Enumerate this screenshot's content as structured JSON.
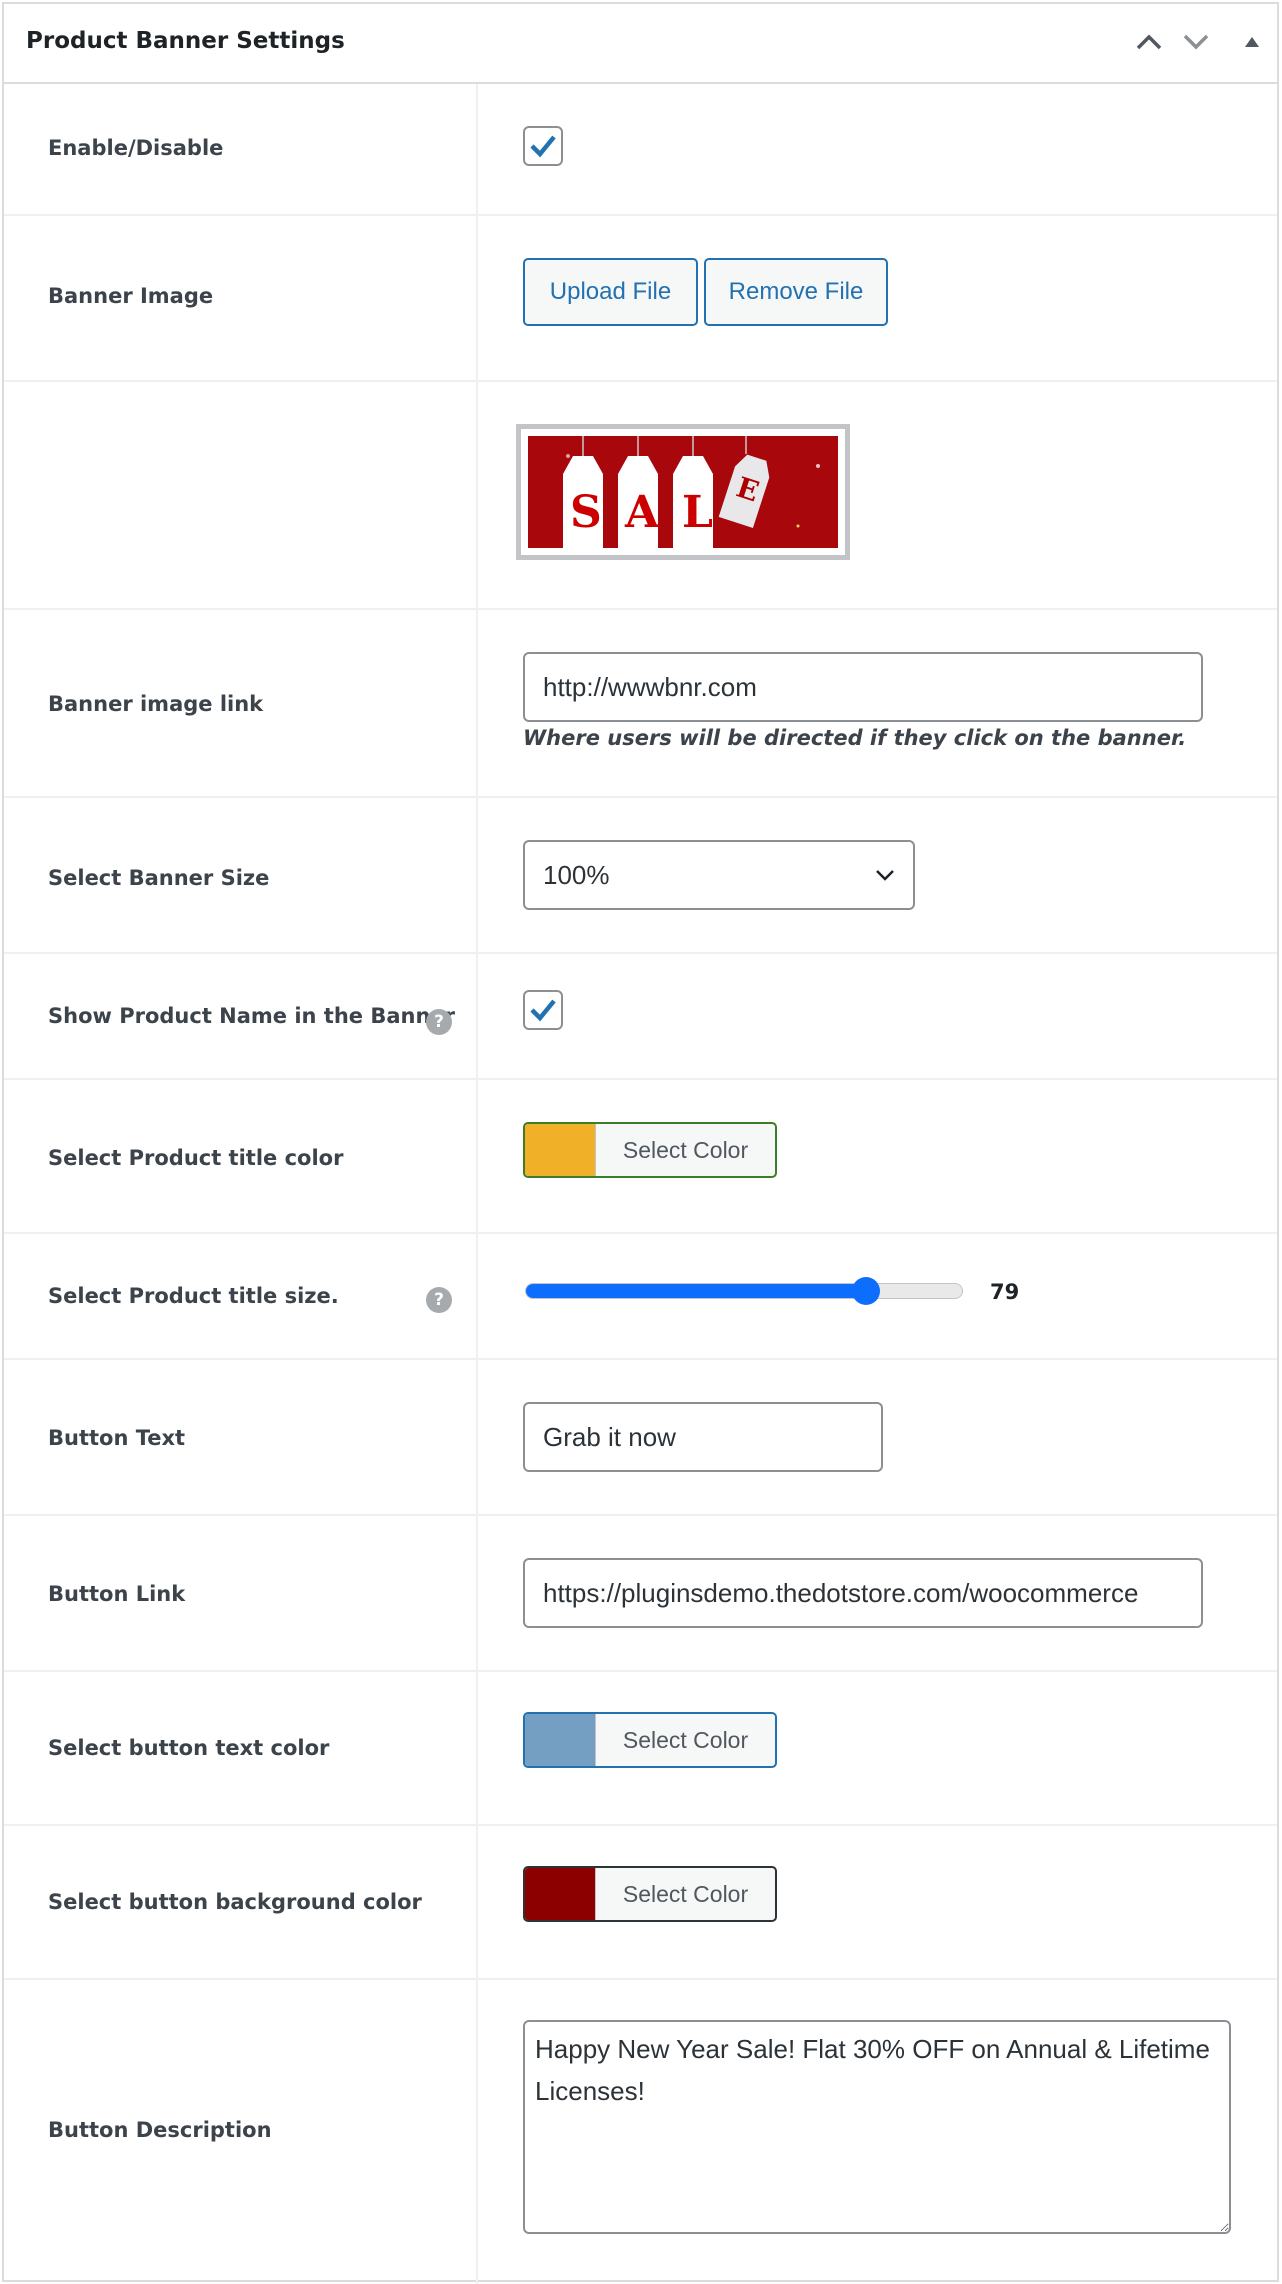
{
  "panel": {
    "title": "Product Banner Settings",
    "controls": [
      "chevron-up-icon",
      "chevron-down-icon",
      "triangle-up-icon"
    ]
  },
  "rows": {
    "enable": {
      "label": "Enable/Disable",
      "checked": true
    },
    "banner_image": {
      "label": "Banner Image",
      "upload_label": "Upload File",
      "remove_label": "Remove File"
    },
    "preview": {
      "letters": [
        "S",
        "A",
        "L",
        "E"
      ]
    },
    "banner_link": {
      "label": "Banner image link",
      "value": "http://wwwbnr.com",
      "description": "Where users will be directed if they click on the banner."
    },
    "banner_size": {
      "label": "Select Banner Size",
      "value": "100%"
    },
    "show_name": {
      "label": "Show Product Name in the Banner",
      "help": "?",
      "checked": true
    },
    "title_color": {
      "label": "Select Product title color",
      "button_label": "Select Color",
      "color": "#F0B027"
    },
    "title_size": {
      "label": "Select Product title size.",
      "help": "?",
      "value": "79",
      "slider_fraction": 0.78
    },
    "button_text": {
      "label": "Button Text",
      "value": "Grab it now"
    },
    "button_link": {
      "label": "Button Link",
      "value": "https://pluginsdemo.thedotstore.com/woocommerce"
    },
    "button_text_color": {
      "label": "Select button text color",
      "button_label": "Select Color",
      "color": "#749FC3"
    },
    "button_bg_color": {
      "label": "Select button background color",
      "button_label": "Select Color",
      "color": "#8C0000"
    },
    "button_description": {
      "label": "Button Description",
      "value": "Happy New Year Sale! Flat 30% OFF on Annual & Lifetime Licenses!"
    }
  },
  "colors": {
    "accent": "#2271B1",
    "checkmark": "#2271B1",
    "slider": "#0D6EFD"
  }
}
